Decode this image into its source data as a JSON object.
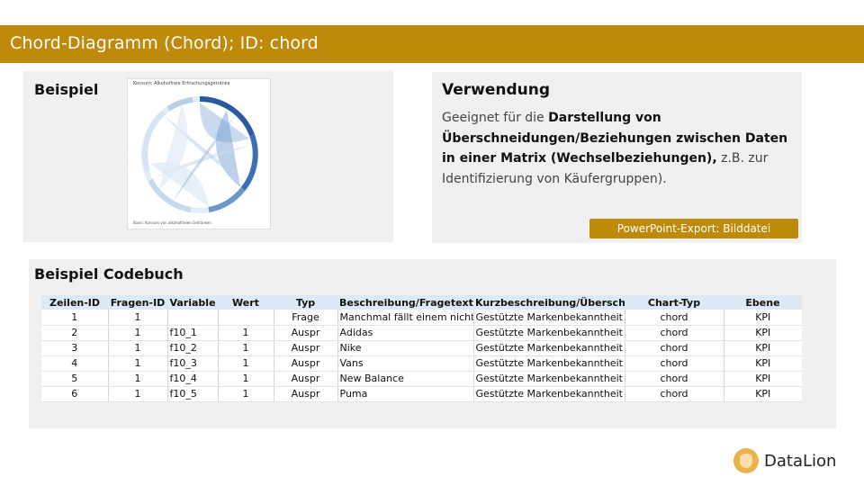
{
  "header": {
    "title": "Chord-Diagramm (Chord); ID: chord"
  },
  "beispiel": {
    "heading": "Beispiel",
    "thumbnail_title": "Konsum: Alkoholfreie Erfrischungsgetränke",
    "thumbnail_footer": "Basis: Konsum von alkoholfreien Getränken"
  },
  "verwendung": {
    "heading": "Verwendung",
    "text_1": "Geeignet für die ",
    "text_bold": "Darstellung von Überschneidungen/Beziehungen zwischen Daten in einer Matrix (Wechselbeziehungen),",
    "text_2": " z.B. zur Identifizierung von Käufergruppen).",
    "export_label": "PowerPoint-Export: Bilddatei"
  },
  "codebuch": {
    "heading": "Beispiel Codebuch",
    "columns": [
      "Zeilen-ID",
      "Fragen-ID",
      "Variable",
      "Wert",
      "Typ",
      "Beschreibung/Fragetext",
      "Kurzbeschreibung/Überschrift",
      "Chart-Typ",
      "Ebene"
    ],
    "rows": [
      [
        "1",
        "1",
        "",
        "",
        "Frage",
        "Manchmal fällt einem nicht a",
        "Gestützte Markenbekanntheit S",
        "chord",
        "KPI"
      ],
      [
        "2",
        "1",
        "f10_1",
        "1",
        "Auspr",
        "Adidas",
        "Gestützte Markenbekanntheit S",
        "chord",
        "KPI"
      ],
      [
        "3",
        "1",
        "f10_2",
        "1",
        "Auspr",
        "Nike",
        "Gestützte Markenbekanntheit S",
        "chord",
        "KPI"
      ],
      [
        "4",
        "1",
        "f10_3",
        "1",
        "Auspr",
        "Vans",
        "Gestützte Markenbekanntheit S",
        "chord",
        "KPI"
      ],
      [
        "5",
        "1",
        "f10_4",
        "1",
        "Auspr",
        "New Balance",
        "Gestützte Markenbekanntheit S",
        "chord",
        "KPI"
      ],
      [
        "6",
        "1",
        "f10_5",
        "1",
        "Auspr",
        "Puma",
        "Gestützte Markenbekanntheit S",
        "chord",
        "KPI"
      ]
    ]
  },
  "brand": {
    "name": "DataLion",
    "logo_icon": "lion-icon"
  },
  "colors": {
    "accent": "#bf8a0a",
    "panel": "#f0f0f0",
    "table_header": "#dde9f5",
    "chord_dark": "#2b5aa0",
    "chord_light": "#c9dcef"
  }
}
